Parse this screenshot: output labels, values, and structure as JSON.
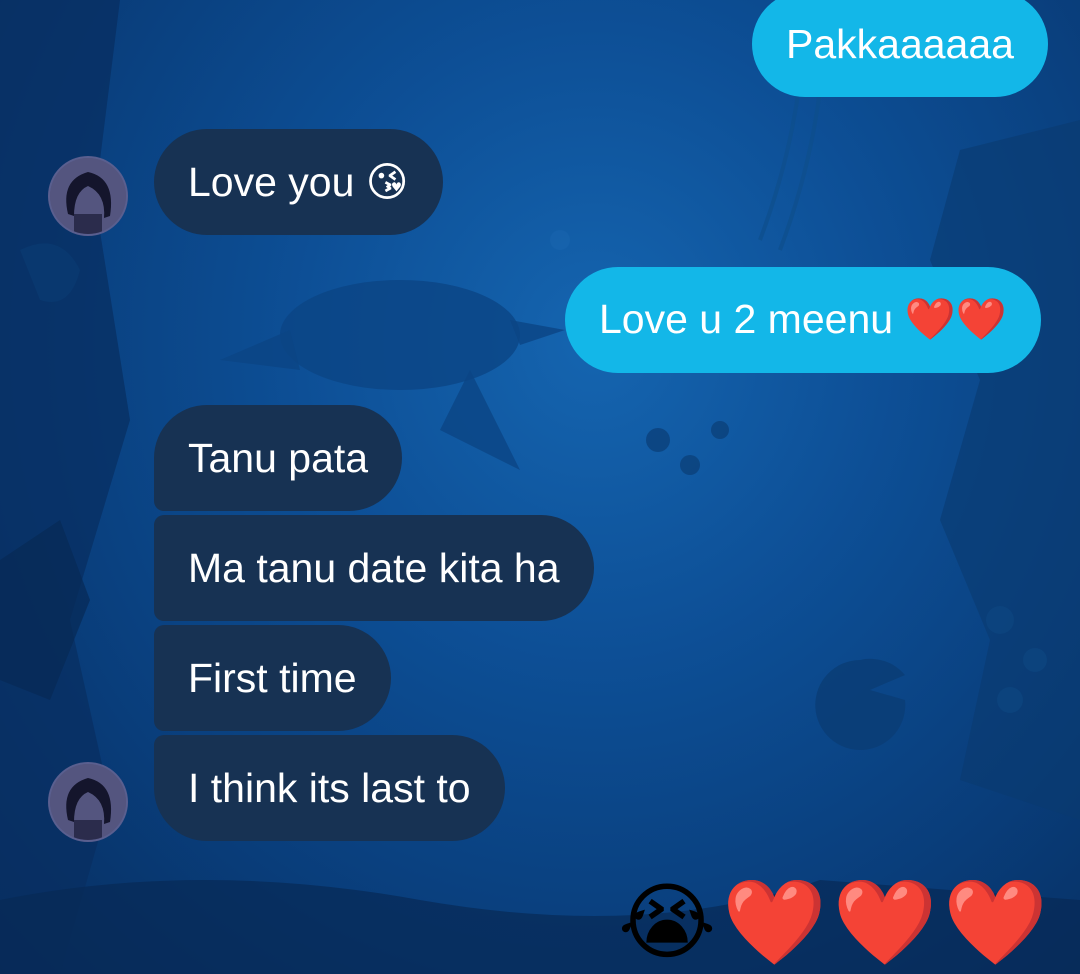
{
  "messages": [
    {
      "direction": "outgoing",
      "text": "Pakkaaaaaa"
    },
    {
      "direction": "incoming",
      "text": "Love you 😘"
    },
    {
      "direction": "outgoing",
      "text": "Love u 2 meenu ❤️❤️"
    },
    {
      "direction": "incoming",
      "text": "Tanu pata"
    },
    {
      "direction": "incoming",
      "text": "Ma tanu date kita ha"
    },
    {
      "direction": "incoming",
      "text": "First time"
    },
    {
      "direction": "incoming",
      "text": "I think its last to"
    }
  ],
  "reactions": "😭❤️❤️❤️",
  "colors": {
    "incoming_bubble": "#173253",
    "outgoing_bubble": "#13b7e8",
    "background": "#0d4f96"
  },
  "icons": {
    "avatar": "avatar-icon"
  }
}
